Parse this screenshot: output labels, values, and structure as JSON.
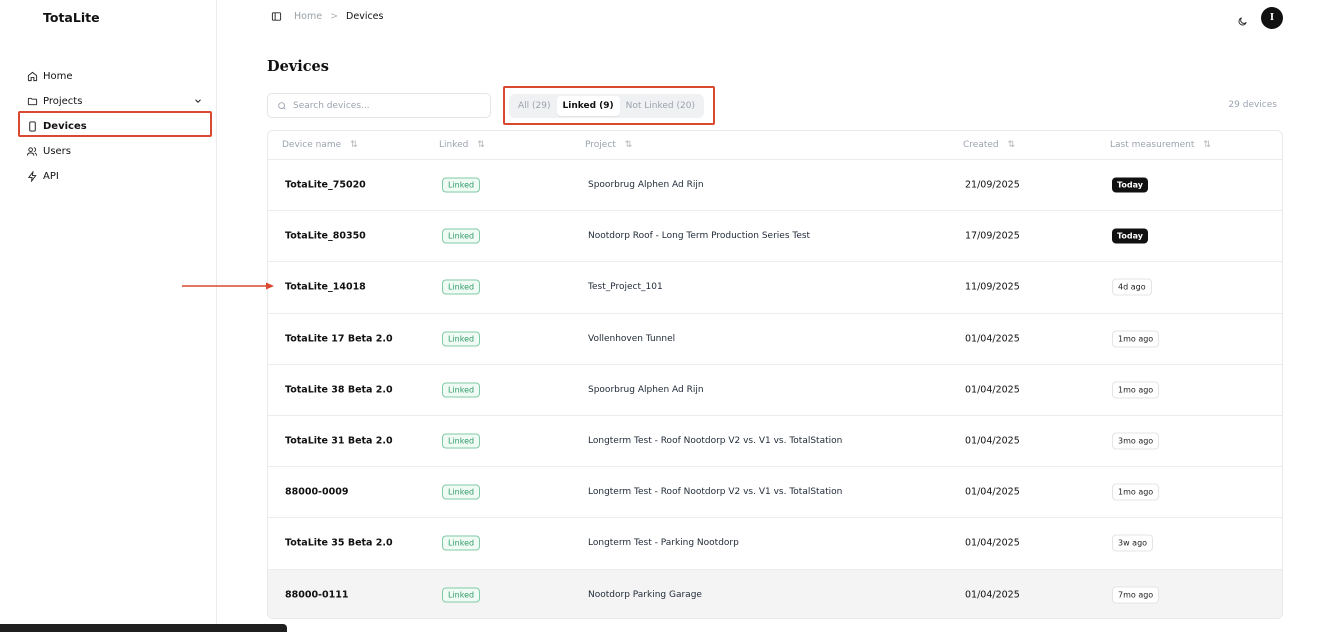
{
  "app": {
    "brand": "TotaLite"
  },
  "sidebar": {
    "items": [
      {
        "label": "Home",
        "icon": "home-icon"
      },
      {
        "label": "Projects",
        "icon": "folder-icon"
      },
      {
        "label": "Devices",
        "icon": "device-icon"
      },
      {
        "label": "Users",
        "icon": "users-icon"
      },
      {
        "label": "API",
        "icon": "zap-icon"
      }
    ]
  },
  "header": {
    "breadcrumb": {
      "home": "Home",
      "separator": ">",
      "current": "Devices"
    },
    "avatar_initial": "I"
  },
  "main": {
    "title": "Devices",
    "search_placeholder": "Search devices...",
    "filters": {
      "all": "All (29)",
      "linked": "Linked (9)",
      "not_linked": "Not Linked (20)"
    },
    "count": "29 devices",
    "columns": {
      "name": "Device name",
      "linked": "Linked",
      "project": "Project",
      "created": "Created",
      "last": "Last measurement"
    },
    "rows": [
      {
        "name": "TotaLite_75020",
        "linked": "Linked",
        "project": "Spoorbrug Alphen Ad Rijn",
        "created": "21/09/2025",
        "last": "Today"
      },
      {
        "name": "TotaLite_80350",
        "linked": "Linked",
        "project": "Nootdorp Roof - Long Term Production Series Test",
        "created": "17/09/2025",
        "last": "Today"
      },
      {
        "name": "TotaLite_14018",
        "linked": "Linked",
        "project": "Test_Project_101",
        "created": "11/09/2025",
        "last": "4d ago"
      },
      {
        "name": "TotaLite 17 Beta 2.0",
        "linked": "Linked",
        "project": "Vollenhoven Tunnel",
        "created": "01/04/2025",
        "last": "1mo ago"
      },
      {
        "name": "TotaLite 38 Beta 2.0",
        "linked": "Linked",
        "project": "Spoorbrug Alphen Ad Rijn",
        "created": "01/04/2025",
        "last": "1mo ago"
      },
      {
        "name": "TotaLite 31 Beta 2.0",
        "linked": "Linked",
        "project": "Longterm Test - Roof Nootdorp V2 vs. V1 vs. TotalStation",
        "created": "01/04/2025",
        "last": "3mo ago"
      },
      {
        "name": "88000-0009",
        "linked": "Linked",
        "project": "Longterm Test - Roof Nootdorp V2 vs. V1 vs. TotalStation",
        "created": "01/04/2025",
        "last": "1mo ago"
      },
      {
        "name": "TotaLite 35 Beta 2.0",
        "linked": "Linked",
        "project": "Longterm Test - Parking Nootdorp",
        "created": "01/04/2025",
        "last": "3w ago"
      },
      {
        "name": "88000-0111",
        "linked": "Linked",
        "project": "Nootdorp Parking Garage",
        "created": "01/04/2025",
        "last": "7mo ago"
      }
    ]
  },
  "colors": {
    "highlight": "#d9482f",
    "linked_green": "#2f9a68"
  }
}
